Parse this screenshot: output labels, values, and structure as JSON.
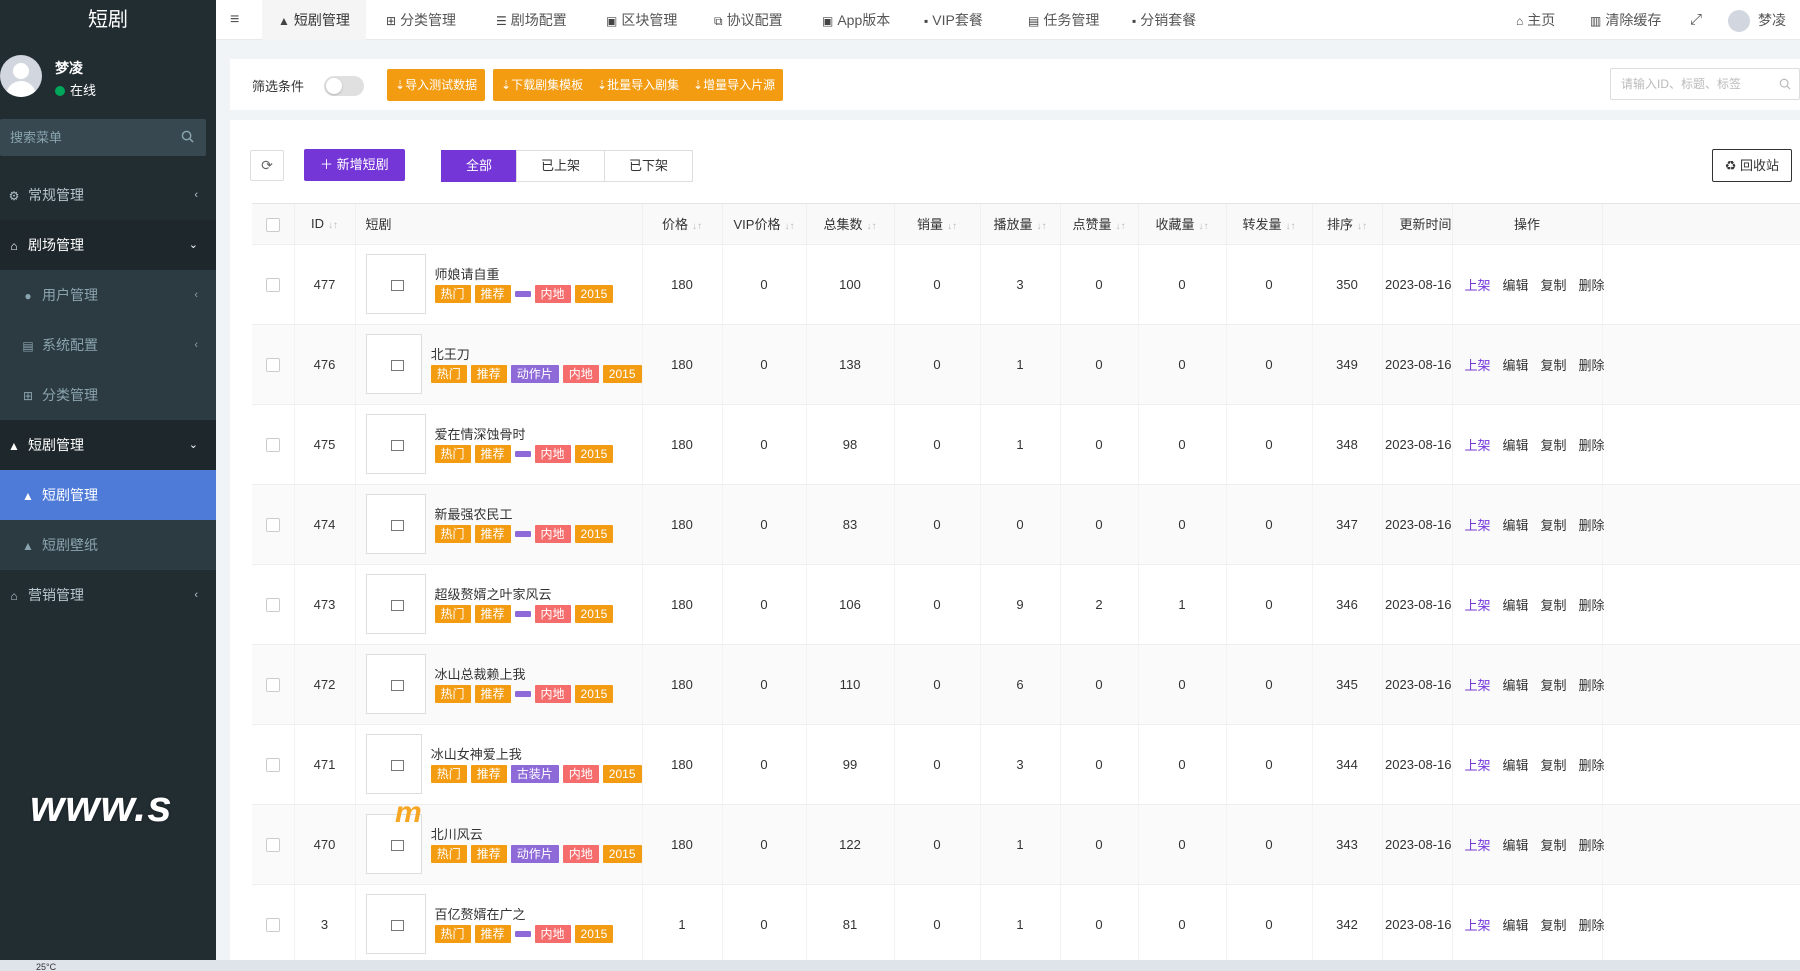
{
  "app": {
    "logo": "短剧"
  },
  "user": {
    "name": "梦凌",
    "status": "在线"
  },
  "search": {
    "placeholder": "搜索菜单"
  },
  "sidebar": [
    {
      "label": "常规管理",
      "icon": "gears-icon"
    },
    {
      "label": "剧场管理",
      "icon": "home-icon"
    },
    {
      "label": "用户管理",
      "icon": "user-icon"
    },
    {
      "label": "系统配置",
      "icon": "file-icon"
    },
    {
      "label": "分类管理",
      "icon": "sitemap-icon"
    },
    {
      "label": "短剧管理",
      "icon": "bag-icon"
    },
    {
      "label": "短剧管理",
      "icon": "bag-icon"
    },
    {
      "label": "短剧壁纸",
      "icon": "bag-icon"
    },
    {
      "label": "营销管理",
      "icon": "home-icon"
    }
  ],
  "topnav": {
    "menu_icon": "≡",
    "tabs": [
      "短剧管理",
      "分类管理",
      "剧场配置",
      "区块管理",
      "协议配置",
      "App版本",
      "VIP套餐",
      "任务管理",
      "分销套餐"
    ],
    "home": "主页",
    "clear_cache": "清除缓存",
    "user": "梦凌"
  },
  "filter": {
    "label": "筛选条件",
    "buttons": [
      "导入测试数据",
      "下载剧集模板",
      "批量导入剧集",
      "增量导入片源"
    ],
    "search_placeholder": "请输入ID、标题、标签"
  },
  "toolbar": {
    "add": "新增短剧",
    "segments": [
      "全部",
      "已上架",
      "已下架"
    ],
    "recycle": "回收站"
  },
  "table": {
    "headers": [
      "ID",
      "短剧",
      "价格",
      "VIP价格",
      "总集数",
      "销量",
      "播放量",
      "点赞量",
      "收藏量",
      "转发量",
      "排序",
      "更新时间",
      "操作"
    ],
    "actions": [
      "上架",
      "编辑",
      "复制",
      "删除"
    ],
    "rows": [
      {
        "id": "477",
        "name": "师娘请自重",
        "tags": [
          "热门",
          "推荐",
          "",
          "内地",
          "2015"
        ],
        "price": "180",
        "vip": "0",
        "eps": "100",
        "sales": "0",
        "plays": "3",
        "likes": "0",
        "favs": "0",
        "shares": "0",
        "sort": "350",
        "date": "2023-08-16"
      },
      {
        "id": "476",
        "name": "北王刀",
        "tags": [
          "热门",
          "推荐",
          "动作片",
          "内地",
          "2015"
        ],
        "price": "180",
        "vip": "0",
        "eps": "138",
        "sales": "0",
        "plays": "1",
        "likes": "0",
        "favs": "0",
        "shares": "0",
        "sort": "349",
        "date": "2023-08-16"
      },
      {
        "id": "475",
        "name": "爱在情深蚀骨时",
        "tags": [
          "热门",
          "推荐",
          "",
          "内地",
          "2015"
        ],
        "price": "180",
        "vip": "0",
        "eps": "98",
        "sales": "0",
        "plays": "1",
        "likes": "0",
        "favs": "0",
        "shares": "0",
        "sort": "348",
        "date": "2023-08-16"
      },
      {
        "id": "474",
        "name": "新最强农民工",
        "tags": [
          "热门",
          "推荐",
          "",
          "内地",
          "2015"
        ],
        "price": "180",
        "vip": "0",
        "eps": "83",
        "sales": "0",
        "plays": "0",
        "likes": "0",
        "favs": "0",
        "shares": "0",
        "sort": "347",
        "date": "2023-08-16"
      },
      {
        "id": "473",
        "name": "超级赘婿之叶家风云",
        "tags": [
          "热门",
          "推荐",
          "",
          "内地",
          "2015"
        ],
        "price": "180",
        "vip": "0",
        "eps": "106",
        "sales": "0",
        "plays": "9",
        "likes": "2",
        "favs": "1",
        "shares": "0",
        "sort": "346",
        "date": "2023-08-16"
      },
      {
        "id": "472",
        "name": "冰山总裁赖上我",
        "tags": [
          "热门",
          "推荐",
          "",
          "内地",
          "2015"
        ],
        "price": "180",
        "vip": "0",
        "eps": "110",
        "sales": "0",
        "plays": "6",
        "likes": "0",
        "favs": "0",
        "shares": "0",
        "sort": "345",
        "date": "2023-08-16"
      },
      {
        "id": "471",
        "name": "冰山女神爱上我",
        "tags": [
          "热门",
          "推荐",
          "古装片",
          "内地",
          "2015"
        ],
        "price": "180",
        "vip": "0",
        "eps": "99",
        "sales": "0",
        "plays": "3",
        "likes": "0",
        "favs": "0",
        "shares": "0",
        "sort": "344",
        "date": "2023-08-16"
      },
      {
        "id": "470",
        "name": "北川风云",
        "tags": [
          "热门",
          "推荐",
          "动作片",
          "内地",
          "2015"
        ],
        "price": "180",
        "vip": "0",
        "eps": "122",
        "sales": "0",
        "plays": "1",
        "likes": "0",
        "favs": "0",
        "shares": "0",
        "sort": "343",
        "date": "2023-08-16"
      },
      {
        "id": "3",
        "name": "百亿赘婿在广之",
        "tags": [
          "热门",
          "推荐",
          "",
          "内地",
          "2015"
        ],
        "price": "1",
        "vip": "0",
        "eps": "81",
        "sales": "0",
        "plays": "1",
        "likes": "0",
        "favs": "0",
        "shares": "0",
        "sort": "342",
        "date": "2023-08-16"
      }
    ]
  },
  "watermark": {
    "text": "www.s",
    "text2": "m"
  },
  "taskbar": {
    "weather": "25°C"
  },
  "colors": {
    "accent": "#7536d8",
    "orange": "#f39c12",
    "sidebar": "#222d32",
    "selected": "#4e7ad8"
  }
}
